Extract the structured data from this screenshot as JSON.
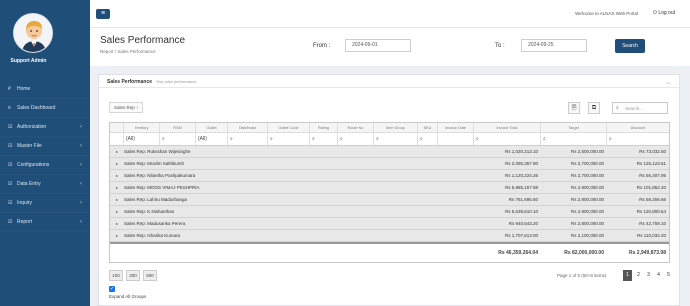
{
  "user": {
    "name": "Support Admin"
  },
  "sidebar": {
    "items": [
      {
        "icon": "#",
        "label": "Home",
        "has_children": false
      },
      {
        "icon": "≡",
        "label": "Sales Dashboard",
        "has_children": false
      },
      {
        "icon": "☑",
        "label": "Authorization",
        "has_children": true
      },
      {
        "icon": "☑",
        "label": "Master File",
        "has_children": true
      },
      {
        "icon": "☑",
        "label": "Configurations",
        "has_children": true
      },
      {
        "icon": "☑",
        "label": "Data Entry",
        "has_children": true
      },
      {
        "icon": "☑",
        "label": "Inquiry",
        "has_children": true
      },
      {
        "icon": "☑",
        "label": "Report",
        "has_children": true
      }
    ]
  },
  "topbar": {
    "menu_icon": "≡",
    "welcome": "Welcome to ALNAS Web Portal",
    "logout": "⏻ Log out"
  },
  "header": {
    "title": "Sales Performance",
    "breadcrumb_root": "Report",
    "breadcrumb_sep": "/",
    "breadcrumb_current": "Sales Performance",
    "from_label": "From :",
    "from_value": "2024-09-01",
    "to_label": "To :",
    "to_value": "2024-09-25",
    "search_label": "Search"
  },
  "panel": {
    "title": "Sales Performance",
    "subtitle": "Rep wise performance",
    "collapse_icon": "︿",
    "group_chip": "Sales Rep",
    "group_chip_icon": "↑",
    "search_placeholder": "Search...",
    "search_icon": "⌕",
    "export_icon": "🗎",
    "columns_icon": "⧉"
  },
  "grid": {
    "columns": [
      "Territory",
      "RSM",
      "Outlet",
      "Distributor",
      "Outlet Code",
      "Rating",
      "Route No",
      "Item Group",
      "SKU",
      "Invoice Date",
      "Invoice Total",
      "Target",
      "Discount"
    ],
    "filters": [
      "(All)",
      "⌕",
      "(All)",
      "⌕",
      "⌕",
      "⌕",
      "⌕",
      "⌕",
      "⌕",
      "",
      "⌕",
      "⌕",
      "⌕"
    ],
    "rows": [
      {
        "name": "Sales Rep: Ruksshan Wijesinghe",
        "total": "Rs 1,020,213.10",
        "target": "Rs 2,500,000.00",
        "discount": "Rs 73,032.50"
      },
      {
        "name": "Sales Rep: Muslim Sathikumh",
        "total": "Rs 2,095,357.90",
        "target": "Rs 2,700,000.00",
        "discount": "Rs 126,123.61"
      },
      {
        "name": "Sales Rep: Nilantha Pushpakumara",
        "total": "Rs 1,120,224.26",
        "target": "Rs 2,700,000.00",
        "discount": "Rs 56,407.95"
      },
      {
        "name": "Sales Rep: MOOS VIMAJ PESHPRIA",
        "total": "Rs 5,985,157.98",
        "target": "Rs 2,900,000.00",
        "discount": "Rs 101,852.20"
      },
      {
        "name": "Sales Rep: Lahiru Madushanga",
        "total": "Rs 761,695.60",
        "target": "Rs 2,900,000.00",
        "discount": "Rs 59,256.66"
      },
      {
        "name": "Sales Rep: K.Nishanthan",
        "total": "Rs 5,039,610.10",
        "target": "Rs 2,900,000.00",
        "discount": "Rs 120,800.64"
      },
      {
        "name": "Sales Rep: Madusanka Perera",
        "total": "Rs 940,543.20",
        "target": "Rs 2,800,000.00",
        "discount": "Rs 42,758.10"
      },
      {
        "name": "Sales Rep: Isharika Kumara",
        "total": "Rs 1,707,613.00",
        "target": "Rs 2,100,000.00",
        "discount": "Rs 110,032.20"
      }
    ],
    "totals": {
      "total": "Rs 46,359,264.04",
      "target": "Rs 82,000,000.00",
      "discount": "Rs 2,949,873.98"
    }
  },
  "pager": {
    "sizes": [
      "100",
      "200",
      "500"
    ],
    "info": "Page 1 of 5 (50+8 items)",
    "pages": [
      "1",
      "2",
      "3",
      "4",
      "5"
    ],
    "active": "1"
  },
  "expand_all": {
    "checked": "✓",
    "label": "Expand All Groups"
  }
}
